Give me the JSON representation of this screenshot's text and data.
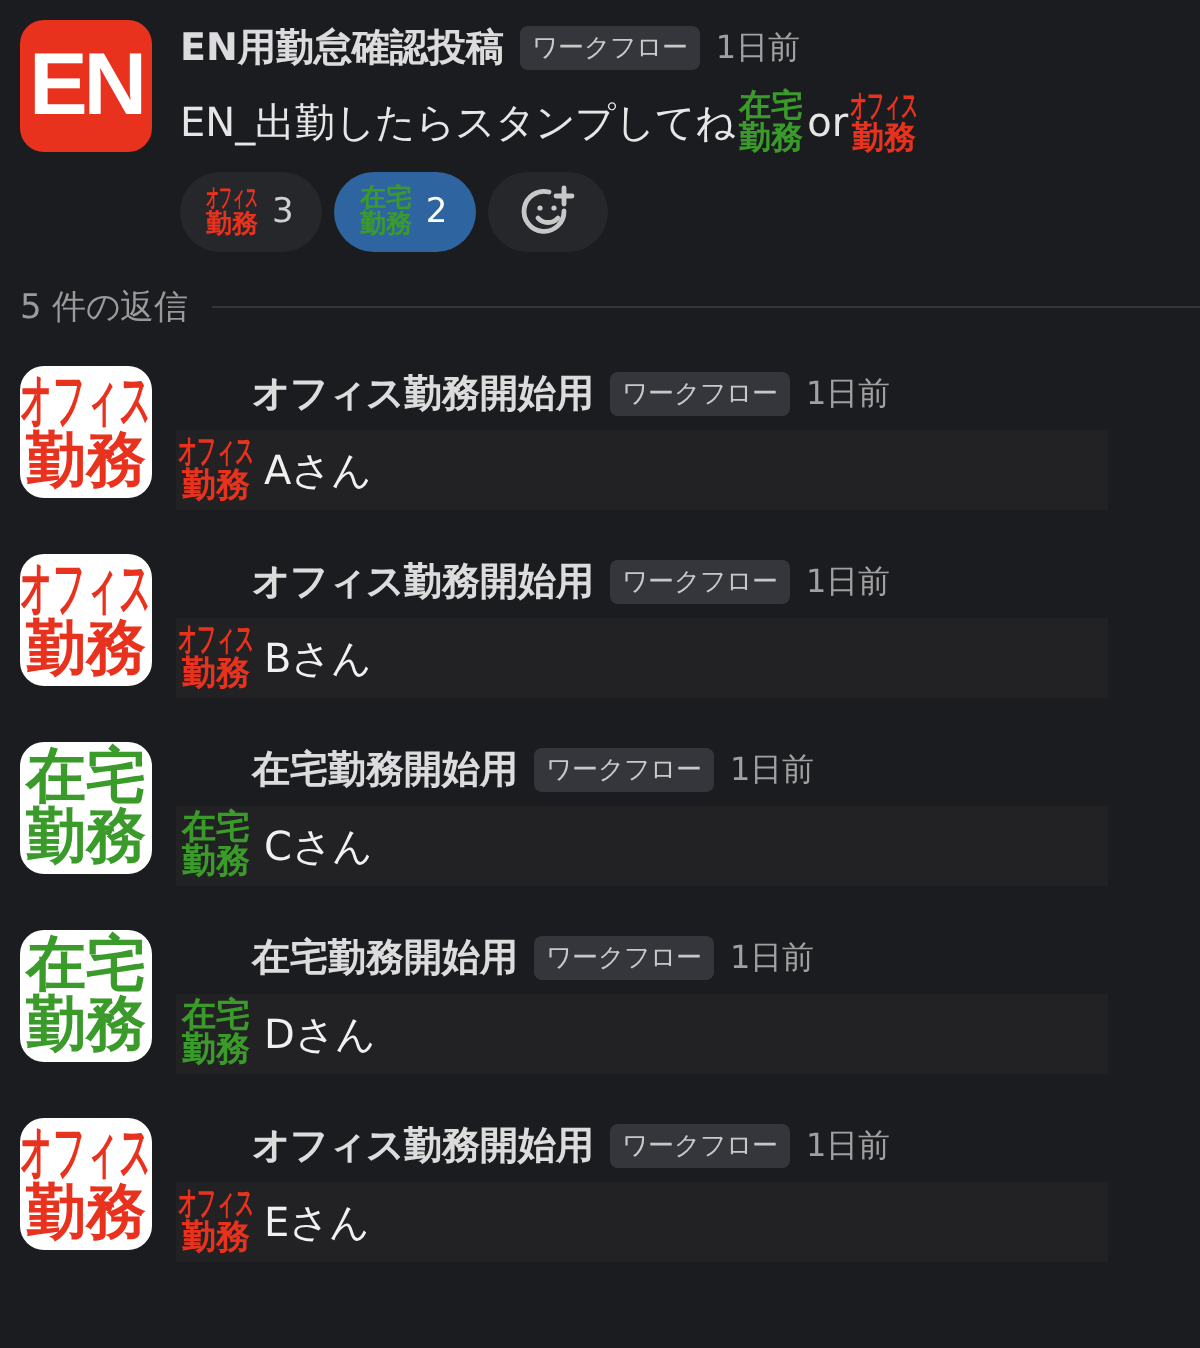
{
  "message": {
    "avatar_text": "EN",
    "title": "EN用勤怠確認投稿",
    "badge": "ワークフロー",
    "time": "1日前",
    "body": [
      {
        "kind": "text",
        "text": "EN_出勤したらスタンプしてね"
      },
      {
        "kind": "emoji",
        "lines": [
          "在宅",
          "勤務"
        ],
        "color": "#3a9a2a"
      },
      {
        "kind": "text",
        "text": "or"
      },
      {
        "kind": "emoji",
        "lines": [
          "オフィス",
          "勤務"
        ],
        "color": "#e8321e"
      }
    ],
    "reactions": [
      {
        "emoji": {
          "lines": [
            "オフィス",
            "勤務"
          ],
          "color": "#e8321e"
        },
        "count": "3",
        "selected": false
      },
      {
        "emoji": {
          "lines": [
            "在宅",
            "勤務"
          ],
          "color": "#3a9a2a"
        },
        "count": "2",
        "selected": true
      }
    ]
  },
  "replies_label": "5 件の返信",
  "replies": [
    {
      "avatar": {
        "lines": [
          "オフィス",
          "勤務"
        ],
        "color": "#e8321e"
      },
      "name": "オフィス勤務開始用",
      "badge": "ワークフロー",
      "time": "1日前",
      "emoji": {
        "lines": [
          "オフィス",
          "勤務"
        ],
        "color": "#e8321e"
      },
      "text": "Aさん"
    },
    {
      "avatar": {
        "lines": [
          "オフィス",
          "勤務"
        ],
        "color": "#e8321e"
      },
      "name": "オフィス勤務開始用",
      "badge": "ワークフロー",
      "time": "1日前",
      "emoji": {
        "lines": [
          "オフィス",
          "勤務"
        ],
        "color": "#e8321e"
      },
      "text": "Bさん"
    },
    {
      "avatar": {
        "lines": [
          "在宅",
          "勤務"
        ],
        "color": "#3a9a2a"
      },
      "name": "在宅勤務開始用",
      "badge": "ワークフロー",
      "time": "1日前",
      "emoji": {
        "lines": [
          "在宅",
          "勤務"
        ],
        "color": "#3a9a2a"
      },
      "text": "Cさん"
    },
    {
      "avatar": {
        "lines": [
          "在宅",
          "勤務"
        ],
        "color": "#3a9a2a"
      },
      "name": "在宅勤務開始用",
      "badge": "ワークフロー",
      "time": "1日前",
      "emoji": {
        "lines": [
          "在宅",
          "勤務"
        ],
        "color": "#3a9a2a"
      },
      "text": "Dさん"
    },
    {
      "avatar": {
        "lines": [
          "オフィス",
          "勤務"
        ],
        "color": "#e8321e"
      },
      "name": "オフィス勤務開始用",
      "badge": "ワークフロー",
      "time": "1日前",
      "emoji": {
        "lines": [
          "オフィス",
          "勤務"
        ],
        "color": "#e8321e"
      },
      "text": "Eさん"
    }
  ]
}
